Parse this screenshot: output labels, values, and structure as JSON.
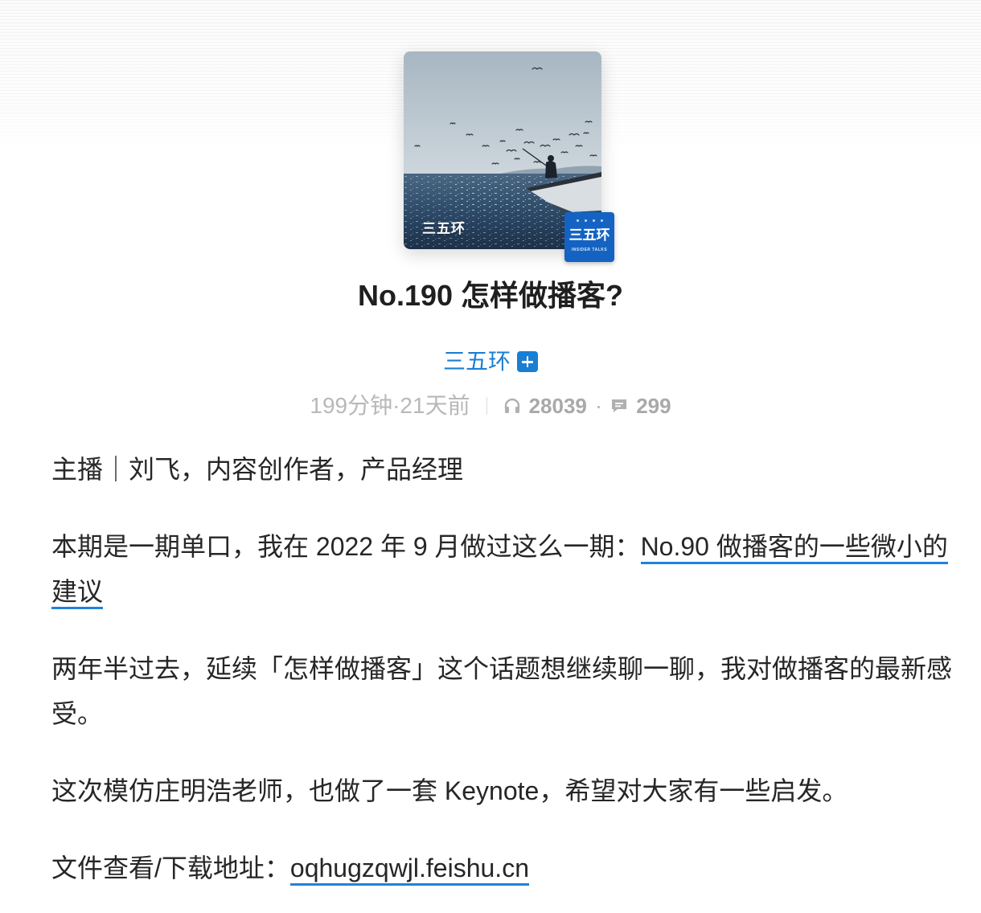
{
  "colors": {
    "accent": "#1a7fd4",
    "link_underline": "#1f82dc",
    "text": "#262626",
    "meta_gray": "#b8b8b8",
    "badge_blue": "#1463c2"
  },
  "cover": {
    "image": "cover-image-sea-fishing-boat-seagulls",
    "overlay_text": "三五环",
    "badge_name": "三五环",
    "badge_sub": "INSIDER TALKS"
  },
  "episode": {
    "title": "No.190 怎样做播客?"
  },
  "podcast": {
    "name": "三五环",
    "follow_icon": "plus-square-icon"
  },
  "meta": {
    "duration": "199分钟",
    "dot": "·",
    "published": "21天前",
    "play_icon": "headphones-icon",
    "plays": "28039",
    "dot2": "·",
    "comment_icon": "comment-icon",
    "comments": "299"
  },
  "description": {
    "p1": "主播｜刘飞，内容创作者，产品经理",
    "p2_before": "本期是一期单口，我在 2022 年 9 月做过这么一期：",
    "p2_link": "No.90 做播客的一些微小的建议",
    "p3": "两年半过去，延续「怎样做播客」这个话题想继续聊一聊，我对做播客的最新感受。",
    "p4": "这次模仿庄明浩老师，也做了一套 Keynote，希望对大家有一些启发。",
    "p5_before": "文件查看/下载地址：",
    "p5_link": "oqhugzqwjl.feishu.cn"
  }
}
